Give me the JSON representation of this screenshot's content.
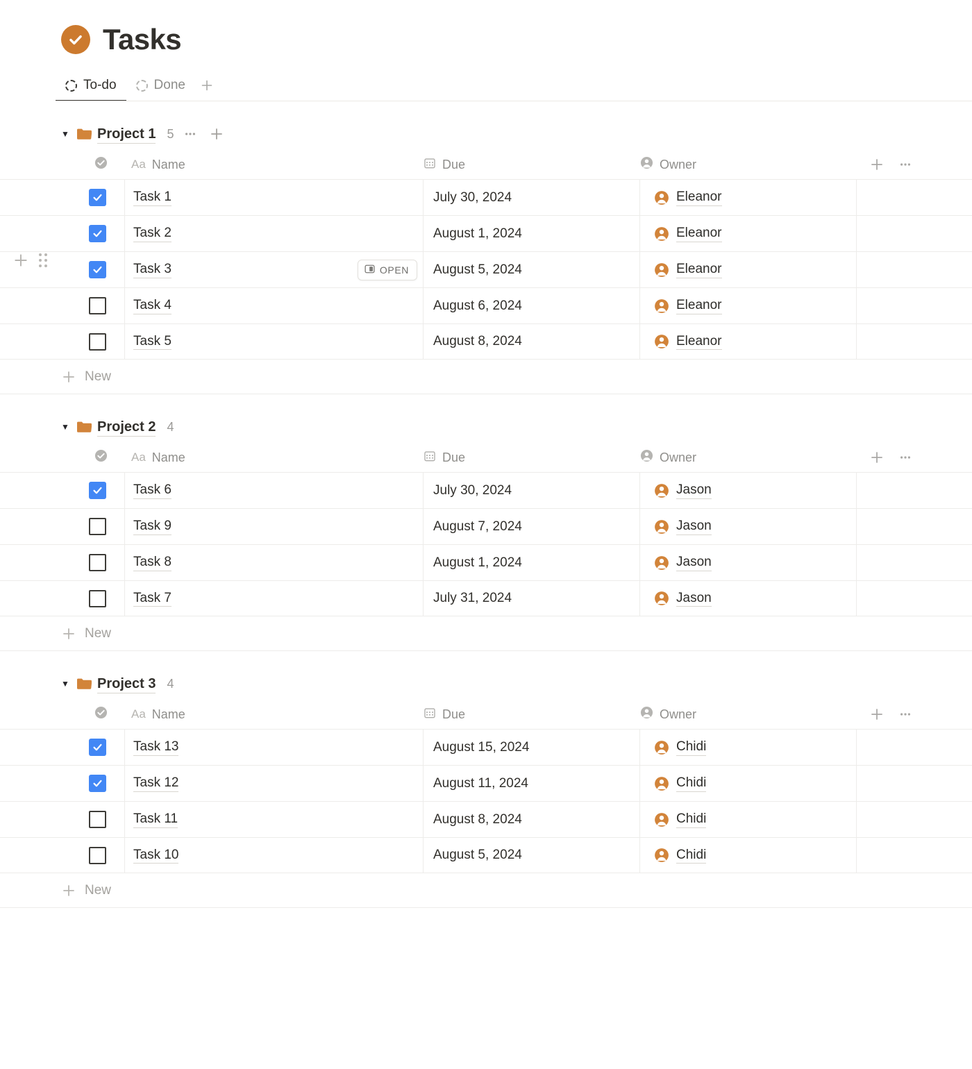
{
  "header": {
    "title": "Tasks",
    "icon": "check-circle-icon",
    "accent_color": "#cc7a2e"
  },
  "tabs": {
    "items": [
      {
        "label": "To-do",
        "icon": "dashed-circle-icon",
        "active": true
      },
      {
        "label": "Done",
        "icon": "dashed-circle-icon",
        "active": false
      }
    ],
    "add_label": "+",
    "add_icon": "plus-icon"
  },
  "columns": {
    "name": "Name",
    "name_type": "Aa",
    "due": "Due",
    "owner": "Owner",
    "name_icon": "check-circle-filled-icon",
    "due_icon": "calendar-icon",
    "owner_icon": "person-icon",
    "add_column_icon": "plus-icon",
    "more_icon": "ellipsis-icon"
  },
  "new_row_label": "New",
  "open_button": {
    "label": "OPEN",
    "icon": "sidebar-panel-icon"
  },
  "row_handles": {
    "add_icon": "plus-icon",
    "drag_icon": "drag-grip-icon"
  },
  "checkbox_color": "#4287f5",
  "projects": [
    {
      "name": "Project 1",
      "count": "5",
      "icon": "folder-icon",
      "expanded": true,
      "show_actions": true,
      "more_icon": "ellipsis-icon",
      "add_icon": "plus-icon",
      "tasks": [
        {
          "name": "Task 1",
          "due": "July 30, 2024",
          "owner": "Eleanor",
          "done": true,
          "show_open": false,
          "show_handles": false
        },
        {
          "name": "Task 2",
          "due": "August 1, 2024",
          "owner": "Eleanor",
          "done": true,
          "show_open": false,
          "show_handles": false
        },
        {
          "name": "Task 3",
          "due": "August 5, 2024",
          "owner": "Eleanor",
          "done": true,
          "show_open": true,
          "show_handles": true
        },
        {
          "name": "Task 4",
          "due": "August 6, 2024",
          "owner": "Eleanor",
          "done": false,
          "show_open": false,
          "show_handles": false
        },
        {
          "name": "Task 5",
          "due": "August 8, 2024",
          "owner": "Eleanor",
          "done": false,
          "show_open": false,
          "show_handles": false
        }
      ]
    },
    {
      "name": "Project 2",
      "count": "4",
      "icon": "folder-icon",
      "expanded": true,
      "show_actions": false,
      "tasks": [
        {
          "name": "Task 6",
          "due": "July 30, 2024",
          "owner": "Jason",
          "done": true,
          "show_open": false,
          "show_handles": false
        },
        {
          "name": "Task 9",
          "due": "August 7, 2024",
          "owner": "Jason",
          "done": false,
          "show_open": false,
          "show_handles": false
        },
        {
          "name": "Task 8",
          "due": "August 1, 2024",
          "owner": "Jason",
          "done": false,
          "show_open": false,
          "show_handles": false
        },
        {
          "name": "Task 7",
          "due": "July 31, 2024",
          "owner": "Jason",
          "done": false,
          "show_open": false,
          "show_handles": false
        }
      ]
    },
    {
      "name": "Project 3",
      "count": "4",
      "icon": "folder-icon",
      "expanded": true,
      "show_actions": false,
      "tasks": [
        {
          "name": "Task 13",
          "due": "August 15, 2024",
          "owner": "Chidi",
          "done": true,
          "show_open": false,
          "show_handles": false
        },
        {
          "name": "Task 12",
          "due": "August 11, 2024",
          "owner": "Chidi",
          "done": true,
          "show_open": false,
          "show_handles": false
        },
        {
          "name": "Task 11",
          "due": "August 8, 2024",
          "owner": "Chidi",
          "done": false,
          "show_open": false,
          "show_handles": false
        },
        {
          "name": "Task 10",
          "due": "August 5, 2024",
          "owner": "Chidi",
          "done": false,
          "show_open": false,
          "show_handles": false
        }
      ]
    }
  ]
}
